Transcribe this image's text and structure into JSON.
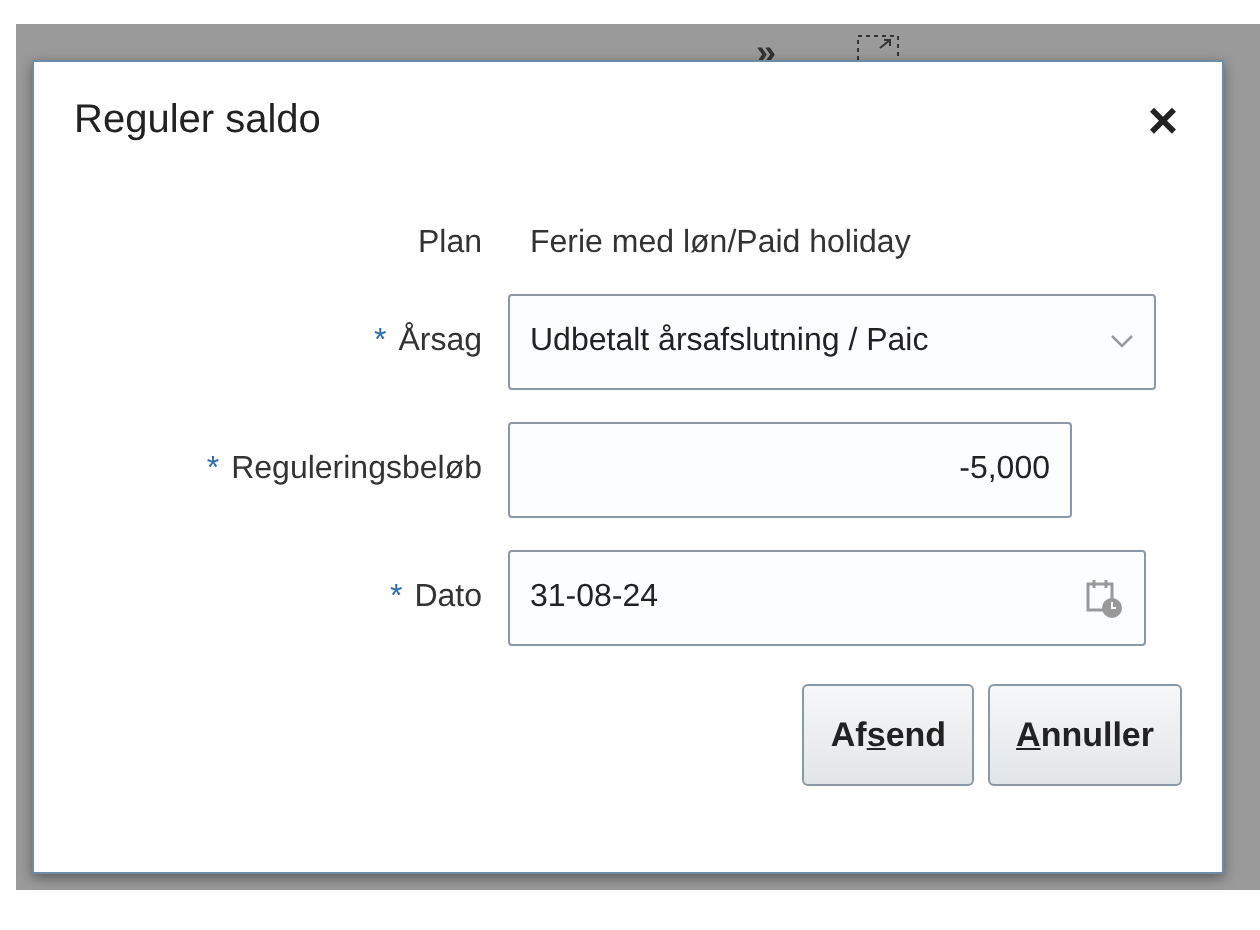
{
  "background_toolbar": {
    "overflow": "»"
  },
  "dialog": {
    "title": "Reguler saldo",
    "close": "×",
    "fields": [
      {
        "kind": "text",
        "label": "Plan",
        "value": "Ferie med løn/Paid holiday"
      },
      {
        "kind": "select",
        "required_mark": "*",
        "label": "Årsag",
        "value": "Udbetalt årsafslutning / Paic"
      },
      {
        "kind": "number",
        "required_mark": "*",
        "label": "Reguleringsbeløb",
        "value": "-5,000"
      },
      {
        "kind": "date",
        "required_mark": "*",
        "label": "Dato",
        "value": "31-08-24"
      }
    ],
    "buttons": [
      {
        "before": "Af",
        "key": "s",
        "after": "end"
      },
      {
        "key": "A",
        "after": "nnuller"
      }
    ]
  }
}
